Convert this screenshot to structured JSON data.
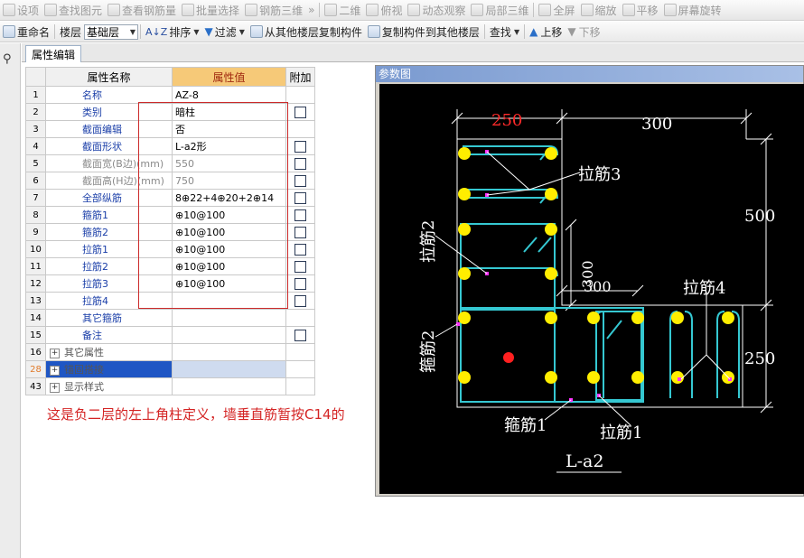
{
  "toolbar1": {
    "items": [
      {
        "label": "设项",
        "icon": "settings-icon"
      },
      {
        "label": "查找图元",
        "icon": "find-icon"
      },
      {
        "label": "查看钢筋量",
        "icon": "rebar-view-icon"
      },
      {
        "label": "批量选择",
        "icon": "batch-select-icon"
      },
      {
        "label": "钢筋三维",
        "icon": "rebar-3d-icon"
      },
      {
        "label": "»",
        "icon": ""
      },
      {
        "label": "二维",
        "icon": "2d-icon"
      },
      {
        "label": "俯视",
        "icon": "top-view-icon"
      },
      {
        "label": "动态观察",
        "icon": "orbit-icon"
      },
      {
        "label": "局部三维",
        "icon": "partial-3d-icon"
      },
      {
        "label": "全屏",
        "icon": "fullscreen-icon"
      },
      {
        "label": "缩放",
        "icon": "zoom-icon"
      },
      {
        "label": "平移",
        "icon": "pan-icon"
      },
      {
        "label": "屏幕旋转",
        "icon": "rotate-icon"
      }
    ]
  },
  "toolbar2": {
    "rename": "重命名",
    "floor_label": "楼层",
    "floor_value": "基础层",
    "sort": "排序",
    "filter": "过滤",
    "copy_from": "从其他楼层复制构件",
    "copy_to": "复制构件到其他楼层",
    "find": "查找",
    "move_up": "上移",
    "move_down": "下移"
  },
  "tab": {
    "label": "属性编辑"
  },
  "grid": {
    "headers": {
      "name": "属性名称",
      "value": "属性值",
      "extra": "附加"
    },
    "rows": [
      {
        "num": "1",
        "name": "名称",
        "value": "AZ-8",
        "check": false
      },
      {
        "num": "2",
        "name": "类别",
        "value": "暗柱",
        "check": true
      },
      {
        "num": "3",
        "name": "截面编辑",
        "value": "否",
        "check": false
      },
      {
        "num": "4",
        "name": "截面形状",
        "value": "L-a2形",
        "check": true
      },
      {
        "num": "5",
        "name": "截面宽(B边)(mm)",
        "value": "550",
        "check": true
      },
      {
        "num": "6",
        "name": "截面高(H边)(mm)",
        "value": "750",
        "check": true
      },
      {
        "num": "7",
        "name": "全部纵筋",
        "value": "8⊕22+4⊕20+2⊕14",
        "check": true
      },
      {
        "num": "8",
        "name": "箍筋1",
        "value": "⊕10@100",
        "check": true
      },
      {
        "num": "9",
        "name": "箍筋2",
        "value": "⊕10@100",
        "check": true
      },
      {
        "num": "10",
        "name": "拉筋1",
        "value": "⊕10@100",
        "check": true
      },
      {
        "num": "11",
        "name": "拉筋2",
        "value": "⊕10@100",
        "check": true
      },
      {
        "num": "12",
        "name": "拉筋3",
        "value": "⊕10@100",
        "check": true
      },
      {
        "num": "13",
        "name": "拉筋4",
        "value": "",
        "check": true
      },
      {
        "num": "14",
        "name": "其它箍筋",
        "value": "",
        "check": false
      },
      {
        "num": "15",
        "name": "备注",
        "value": "",
        "check": true
      },
      {
        "num": "16",
        "name": "其它属性",
        "value": "",
        "check": false
      },
      {
        "num": "28",
        "name": "锚固搭接",
        "value": "",
        "check": false
      },
      {
        "num": "43",
        "name": "显示样式",
        "value": "",
        "check": false
      }
    ]
  },
  "note": "这是负二层的左上角柱定义，墙垂直筋暂按C14的",
  "panel": {
    "title": "参数图",
    "dims": {
      "top_left": "250",
      "top_right": "300",
      "right_upper": "500",
      "right_lower": "250",
      "inner_v": "300",
      "inner_h": "300"
    },
    "labels": {
      "tie3": "拉筋3",
      "tie2": "拉筋2",
      "tie4": "拉筋4",
      "stirrup2": "箍筋2",
      "stirrup1": "箍筋1",
      "tie1": "拉筋1",
      "shape": "L-a2"
    },
    "colors": {
      "stirrup": "#35c8d2",
      "bar": "#ffee00",
      "marker": "#ff33ff",
      "dim": "#ffffff",
      "highlight": "#ff2020"
    }
  }
}
